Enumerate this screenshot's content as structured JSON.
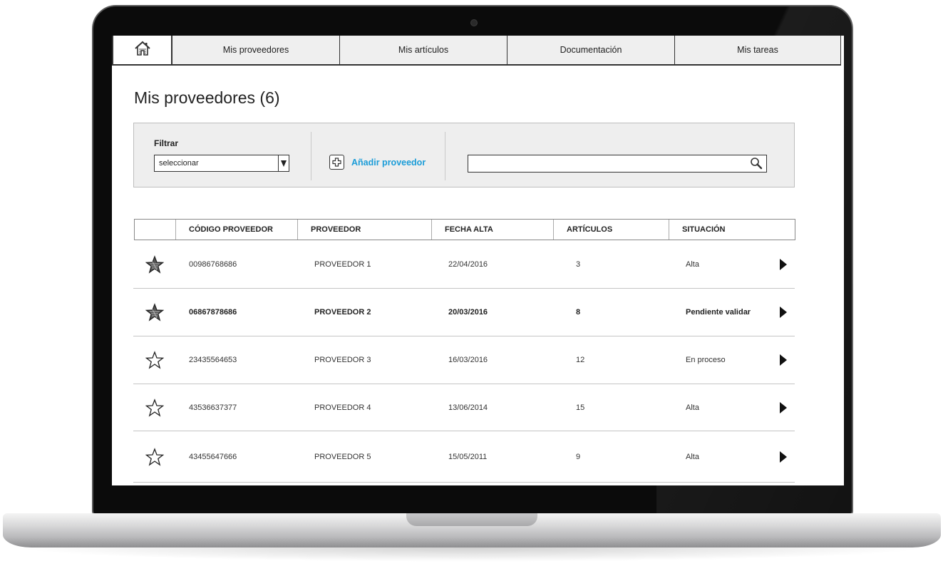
{
  "nav": {
    "home_icon": "home-icon",
    "tabs": [
      {
        "label": "Mis proveedores"
      },
      {
        "label": "Mis artículos"
      },
      {
        "label": "Documentación"
      },
      {
        "label": "Mis tareas"
      }
    ]
  },
  "page": {
    "title": "Mis proveedores (6)"
  },
  "toolbar": {
    "filter_label": "Filtrar",
    "filter_value": "seleccionar",
    "add_label": "Añadir proveedor",
    "search_value": ""
  },
  "table": {
    "headers": [
      "CÓDIGO PROVEEDOR",
      "PROVEEDOR",
      "FECHA ALTA",
      "ARTÍCULOS",
      "SITUACIÓN"
    ],
    "rows": [
      {
        "starred": true,
        "code": "00986768686",
        "name": "PROVEEDOR 1",
        "date": "22/04/2016",
        "articles": "3",
        "status": "Alta",
        "bold": false
      },
      {
        "starred": true,
        "code": "06867878686",
        "name": "PROVEEDOR 2",
        "date": "20/03/2016",
        "articles": "8",
        "status": "Pendiente validar",
        "bold": true
      },
      {
        "starred": false,
        "code": "23435564653",
        "name": "PROVEEDOR 3",
        "date": "16/03/2016",
        "articles": "12",
        "status": "En proceso",
        "bold": false
      },
      {
        "starred": false,
        "code": "43536637377",
        "name": "PROVEEDOR 4",
        "date": "13/06/2014",
        "articles": "15",
        "status": "Alta",
        "bold": false
      },
      {
        "starred": false,
        "code": "43455647666",
        "name": "PROVEEDOR 5",
        "date": "15/05/2011",
        "articles": "9",
        "status": "Alta",
        "bold": false
      }
    ]
  },
  "colors": {
    "accent": "#1a9cd8",
    "nav_bg": "#efefef",
    "toolbar_bg": "#eeeeee"
  }
}
